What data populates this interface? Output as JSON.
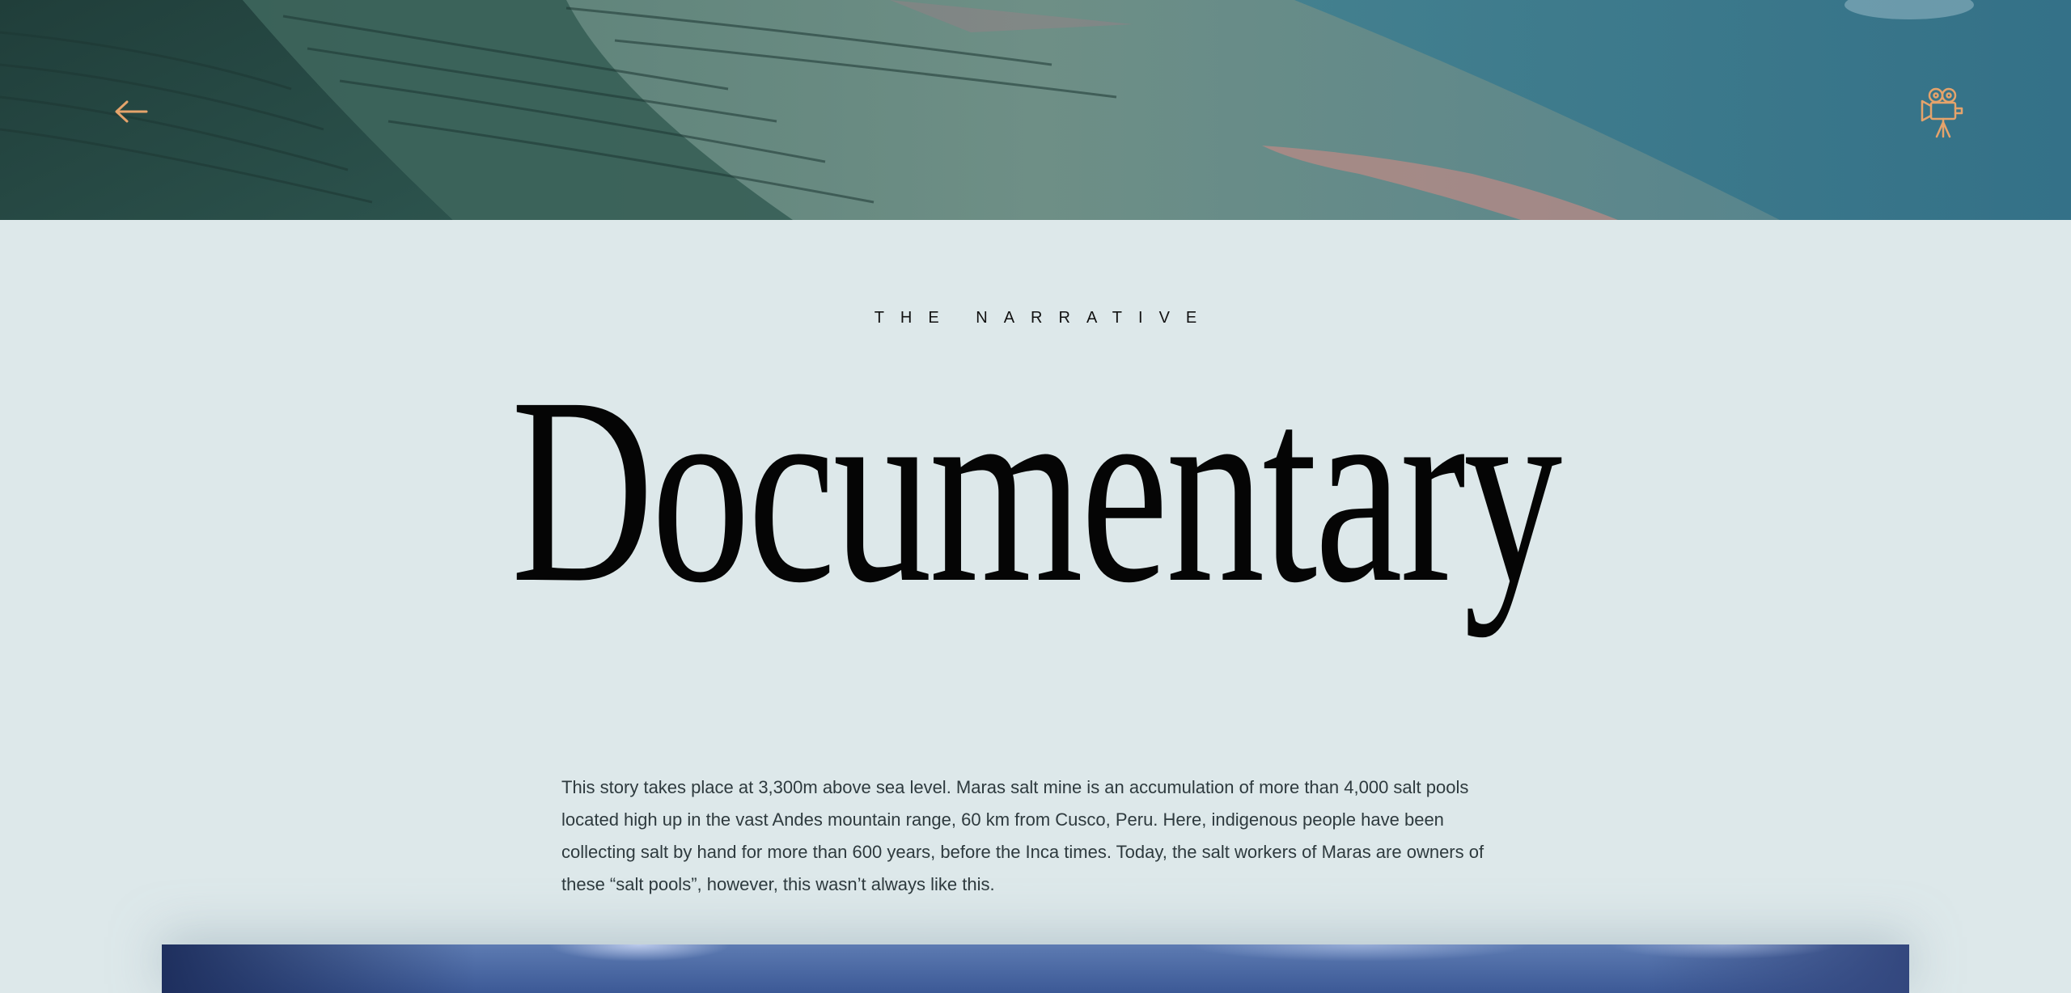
{
  "header": {
    "back_icon": "arrow-left-icon",
    "camera_icon": "movie-camera-icon",
    "accent_color": "#e5a36b"
  },
  "section": {
    "eyebrow": "THE NARRATIVE",
    "title": "Documentary",
    "body": "This story takes place at 3,300m above sea level. Maras salt mine is an accumulation of more than 4,000 salt pools located high up in the vast Andes mountain range, 60 km from Cusco, Peru. Here, indigenous people have been collecting salt by hand for more than 600 years, before the Inca times. Today, the salt workers of Maras are owners of these “salt pools”, however, this wasn’t always like this."
  },
  "colors": {
    "background": "#dde8ea",
    "title": "#050505",
    "body_text": "#2e3a3e"
  }
}
